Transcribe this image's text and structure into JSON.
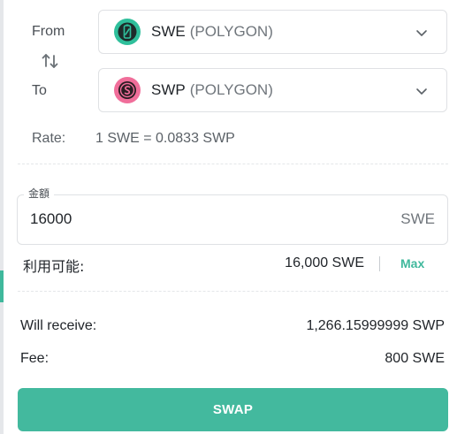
{
  "from": {
    "label": "From",
    "symbol": "SWE",
    "network": "(POLYGON)",
    "icon": "swe-token-icon",
    "icon_color": "#2fbf9b"
  },
  "to": {
    "label": "To",
    "symbol": "SWP",
    "network": "(POLYGON)",
    "icon": "swp-token-icon",
    "icon_color": "#f06e9a"
  },
  "rate": {
    "label": "Rate:",
    "value": "1 SWE = 0.0833 SWP"
  },
  "amount": {
    "legend": "金額",
    "value": "16000",
    "unit": "SWE"
  },
  "available": {
    "label": "利用可能:",
    "value": "16,000 SWE",
    "max_label": "Max"
  },
  "summary": {
    "receive_label": "Will receive:",
    "receive_value": "1,266.15999999 SWP",
    "fee_label": "Fee:",
    "fee_value": "800 SWE"
  },
  "swap_button": {
    "label": "SWAP",
    "color": "#43b99e"
  },
  "colors": {
    "accent": "#3fb89c",
    "border": "#dfe1e4"
  }
}
